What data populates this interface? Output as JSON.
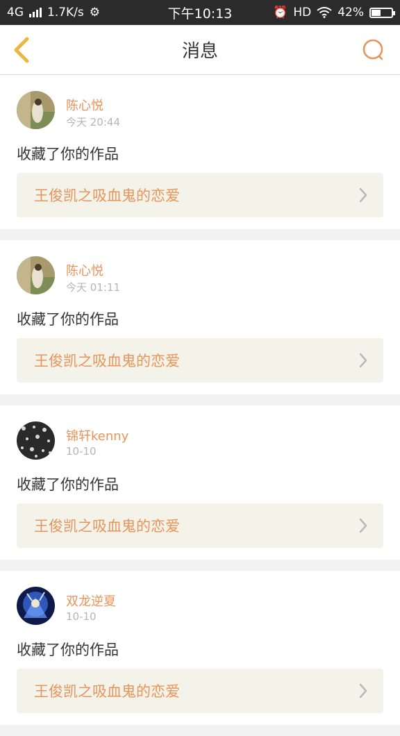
{
  "status_bar": {
    "network": "4G",
    "speed": "1.7K/s",
    "time": "下午10:13",
    "hd": "HD",
    "battery": "42%",
    "battery_level": 0.42
  },
  "nav": {
    "title": "消息",
    "back_icon": "chevron-left-icon",
    "search_icon": "search-icon"
  },
  "messages": [
    {
      "user": "陈心悦",
      "time": "今天 20:44",
      "action": "收藏了你的作品",
      "work": "王俊凯之吸血鬼的恋爱"
    },
    {
      "user": "陈心悦",
      "time": "今天 01:11",
      "action": "收藏了你的作品",
      "work": "王俊凯之吸血鬼的恋爱"
    },
    {
      "user": "锦轩kenny",
      "time": "10-10",
      "action": "收藏了你的作品",
      "work": "王俊凯之吸血鬼的恋爱"
    },
    {
      "user": "双龙逆夏",
      "time": "10-10",
      "action": "收藏了你的作品",
      "work": "王俊凯之吸血鬼的恋爱"
    }
  ],
  "colors": {
    "accent": "#e8935a",
    "back_icon": "#e8b840",
    "status_bar_bg": "#2b2b2b"
  }
}
